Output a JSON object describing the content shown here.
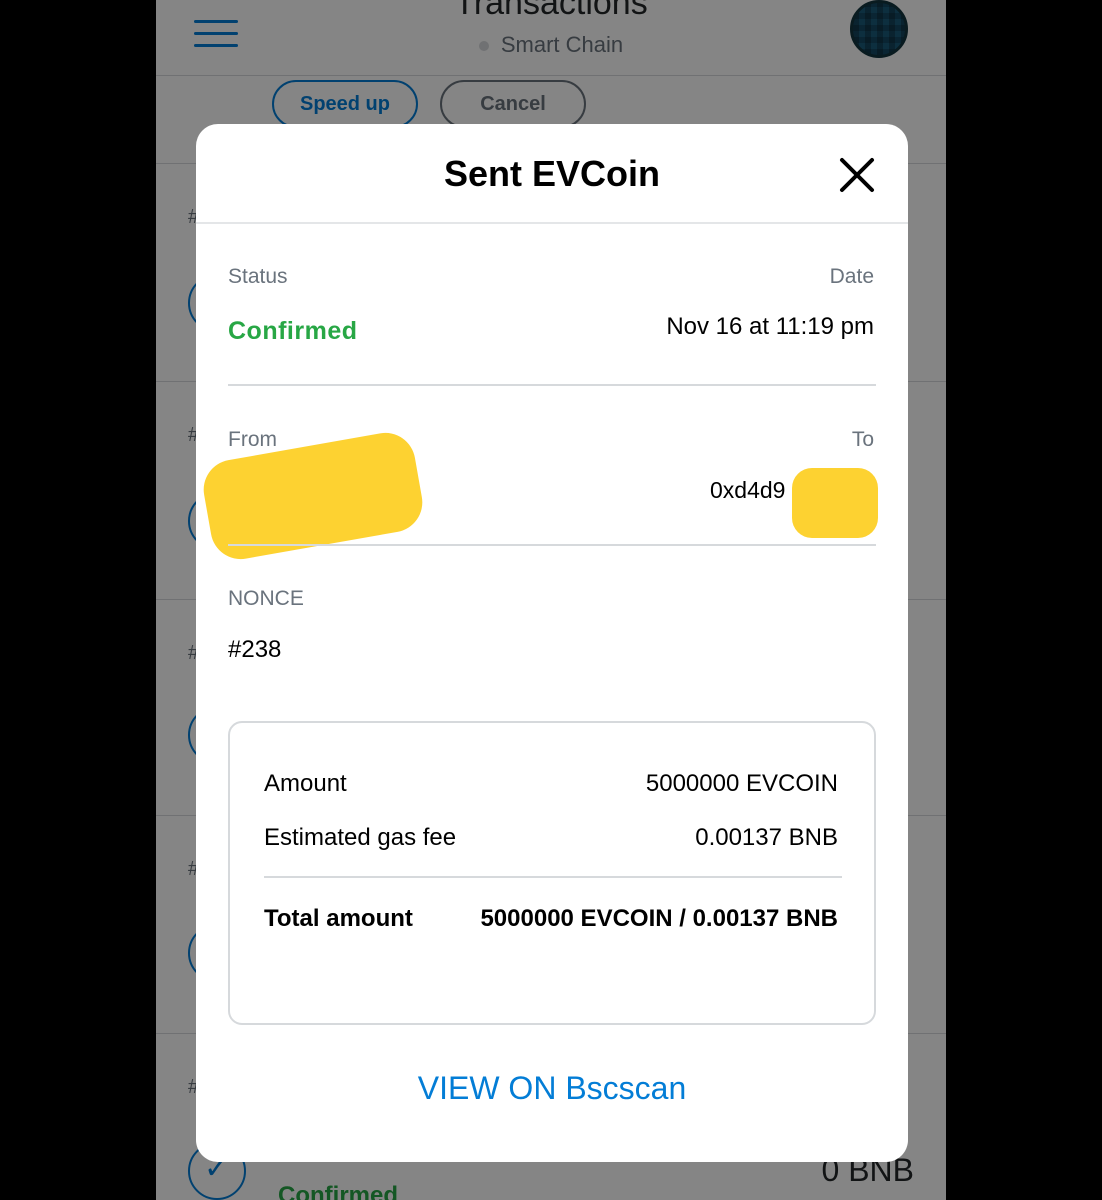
{
  "background_screen": {
    "title": "Transactions",
    "network": "Smart Chain",
    "speed_up_label": "Speed up",
    "cancel_label": "Cancel",
    "last_row_amount": "0 BNB",
    "last_row_status": "Confirmed"
  },
  "modal": {
    "title": "Sent EVCoin",
    "status_label": "Status",
    "status_value": "Confirmed",
    "date_label": "Date",
    "date_value": "Nov 16 at 11:19 pm",
    "from_label": "From",
    "to_label": "To",
    "to_value": "0xd4d9",
    "nonce_label": "NONCE",
    "nonce_value": "#238",
    "summary": {
      "amount_label": "Amount",
      "amount_value": "5000000 EVCOIN",
      "gas_label": "Estimated gas fee",
      "gas_value": "0.00137 BNB",
      "total_label": "Total amount",
      "total_value": "5000000 EVCOIN / 0.00137 BNB"
    },
    "link_label": "VIEW ON Bscscan"
  },
  "colors": {
    "accent_blue": "#037dd6",
    "confirmed_green": "#28a745",
    "redaction_yellow": "#fdd026"
  }
}
